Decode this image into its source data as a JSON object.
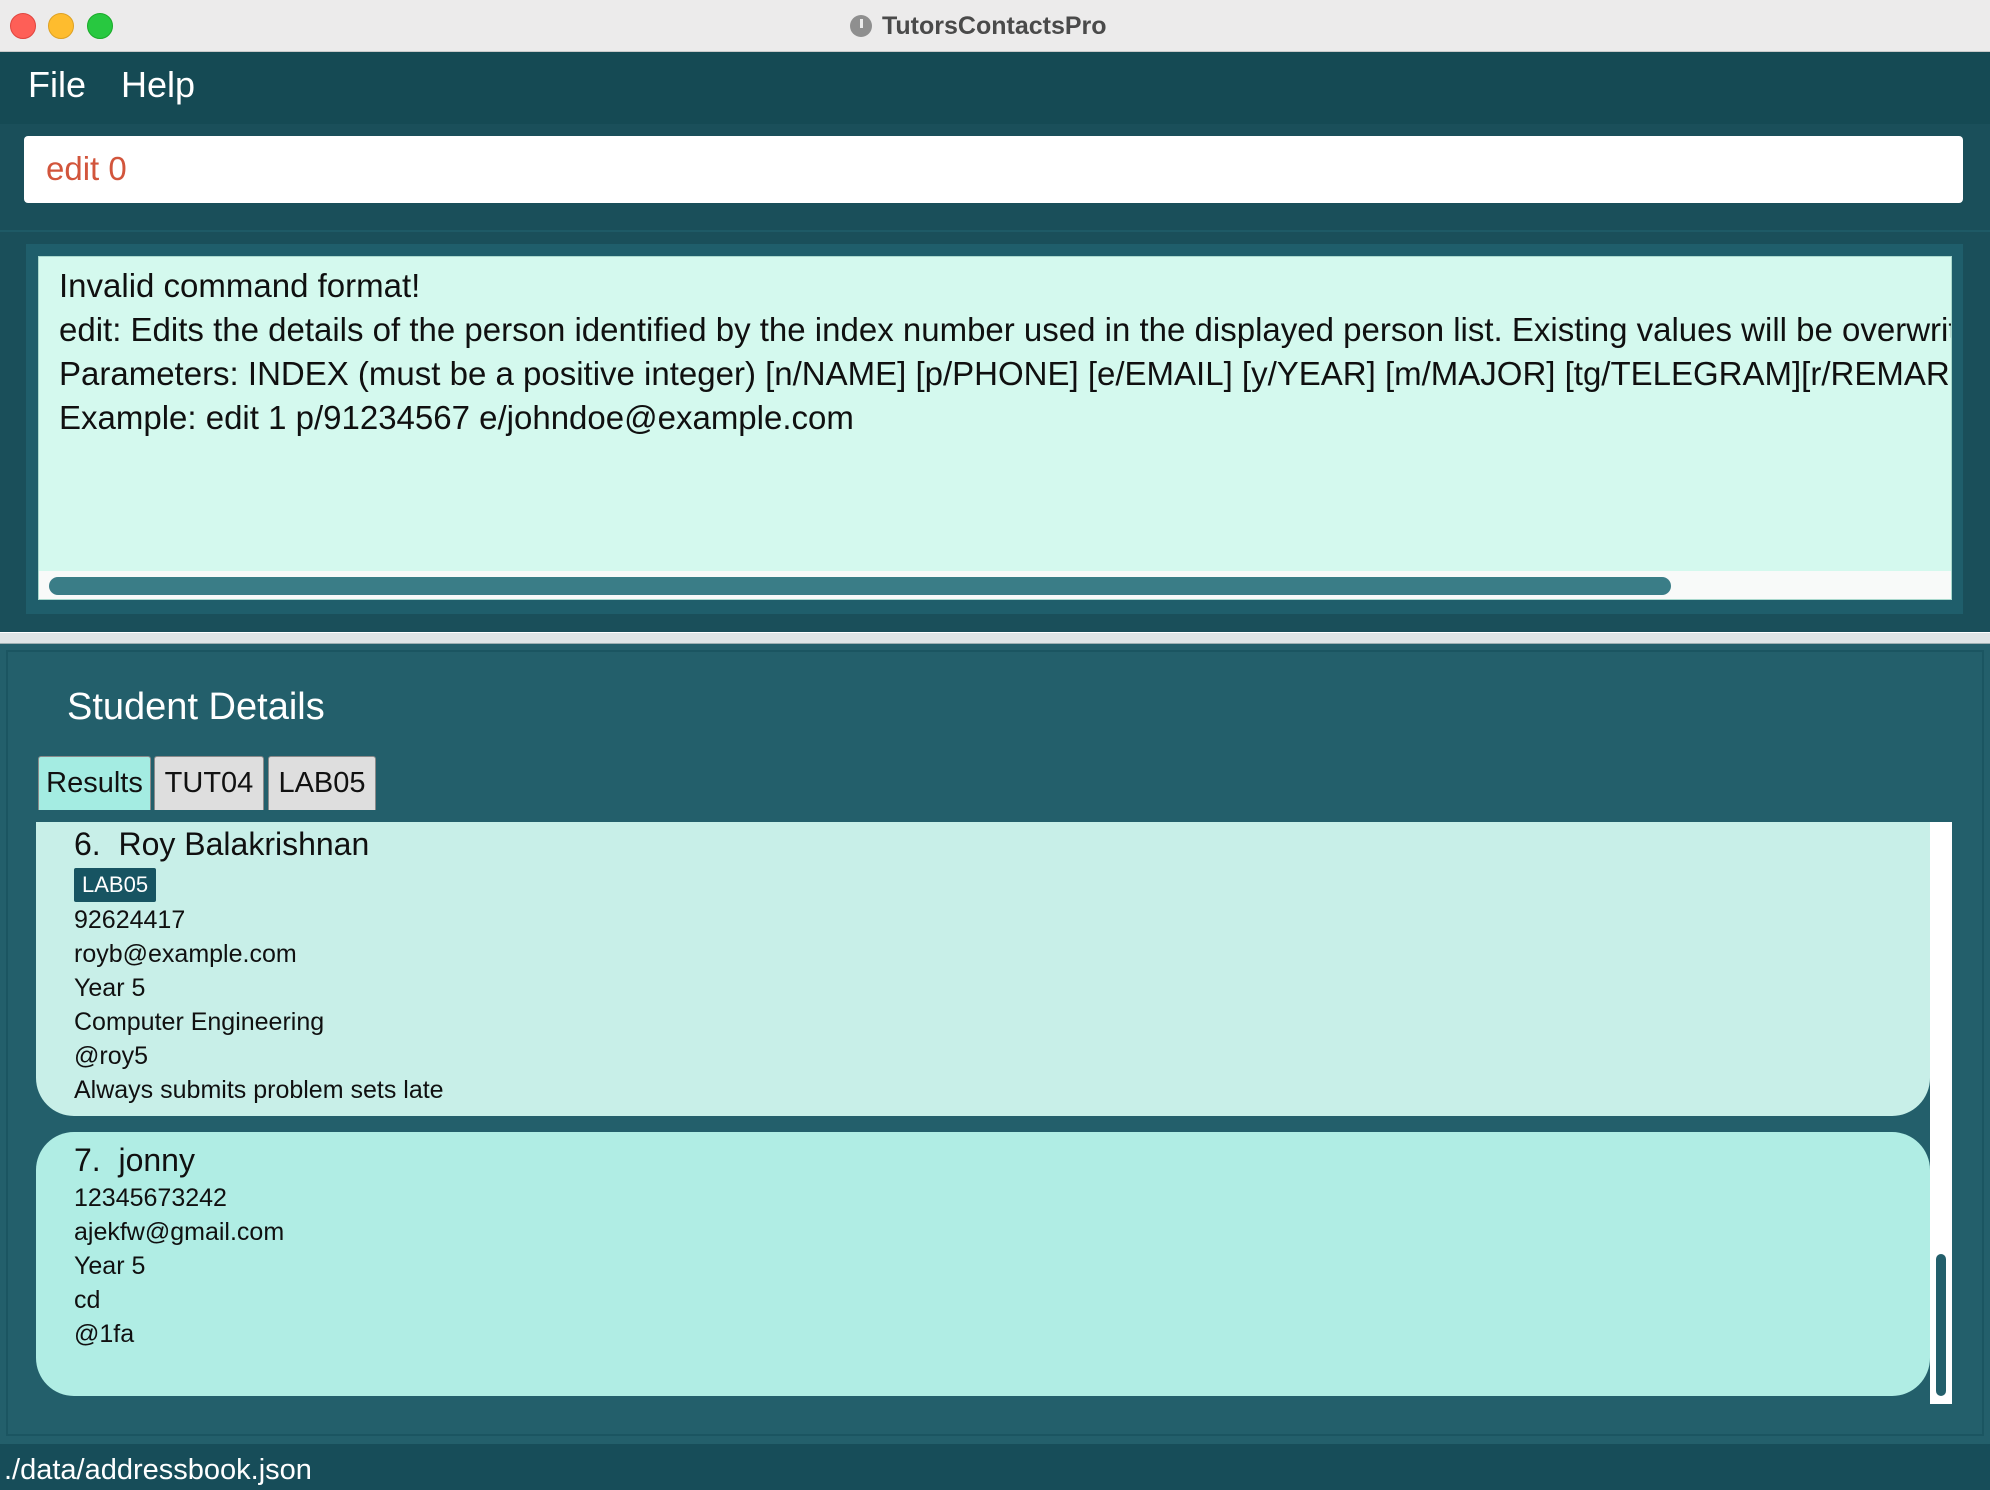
{
  "window": {
    "title": "TutorsContactsPro"
  },
  "menu": {
    "file": "File",
    "help": "Help"
  },
  "command": {
    "value": "edit 0"
  },
  "result": {
    "lines": [
      "Invalid command format!",
      "edit: Edits the details of the person identified by the index number used in the displayed person list. Existing values will be overwritten by the input values.",
      "Parameters: INDEX (must be a positive integer) [n/NAME] [p/PHONE] [e/EMAIL] [y/YEAR] [m/MAJOR] [tg/TELEGRAM][r/REMARK] [g/GROUP]...",
      "Example: edit 1 p/91234567 e/johndoe@example.com"
    ]
  },
  "details": {
    "heading": "Student Details",
    "tabs": [
      "Results",
      "TUT04",
      "LAB05"
    ],
    "persons": [
      {
        "index": "6.",
        "name": "Roy Balakrishnan",
        "tag": "LAB05",
        "phone": "92624417",
        "email": "royb@example.com",
        "year": "Year 5",
        "major": "Computer Engineering",
        "telegram": "@roy5",
        "remark": "Always submits problem sets late"
      },
      {
        "index": "7.",
        "name": "jonny",
        "phone": "12345673242",
        "email": "ajekfw@gmail.com",
        "year": "Year 5",
        "major": "cd",
        "telegram": "@1fa"
      }
    ]
  },
  "status": {
    "path": "./data/addressbook.json"
  }
}
